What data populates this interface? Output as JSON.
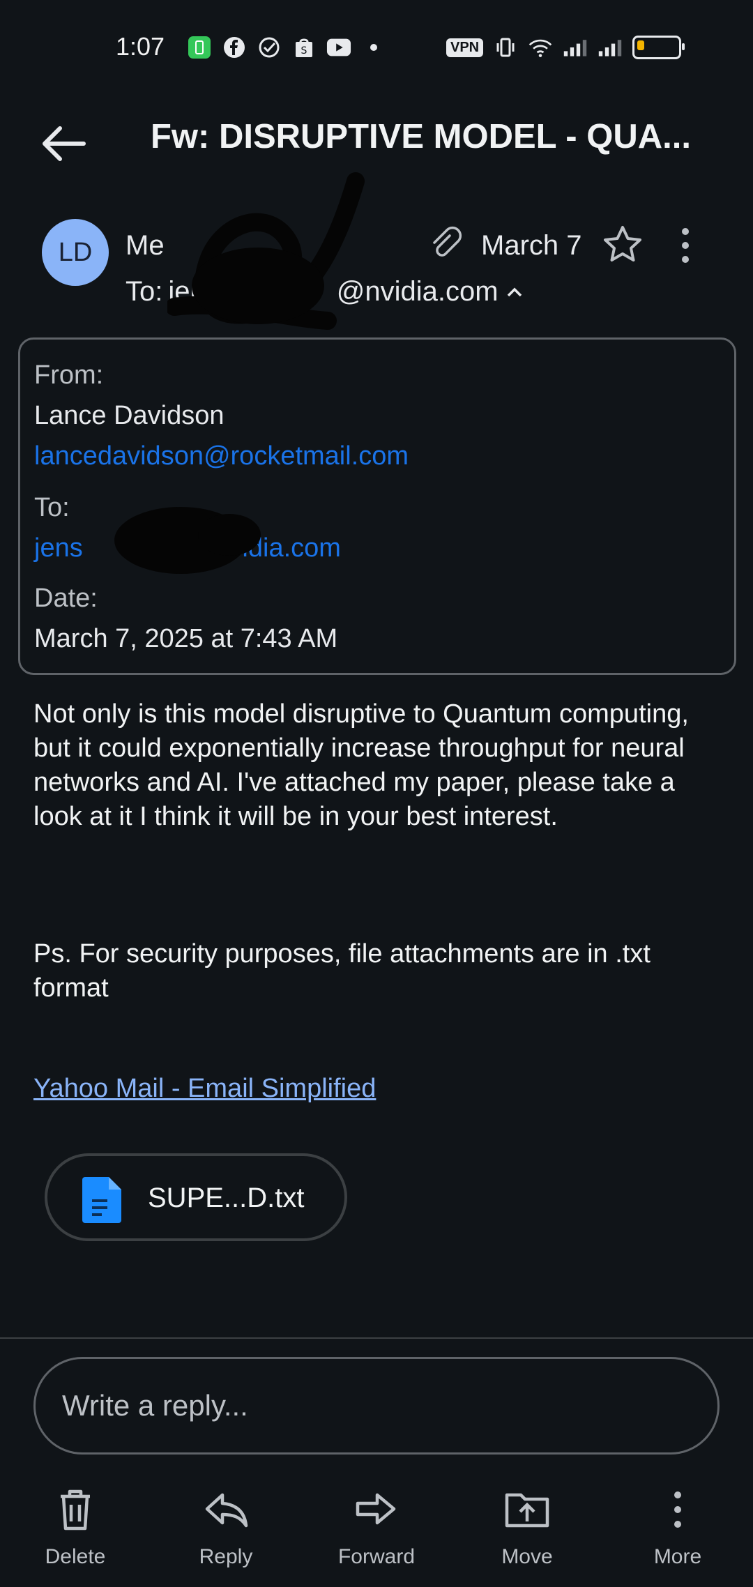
{
  "status_bar": {
    "time": "1:07",
    "vpn_label": "VPN"
  },
  "header": {
    "subject": "Fw: DISRUPTIVE MODEL - QUA..."
  },
  "message": {
    "avatar_initials": "LD",
    "sender": "Me",
    "date": "March 7",
    "to_prefix": "To:",
    "to_visible_start": "jens",
    "to_visible_end": "@nvidia.com"
  },
  "forwarded": {
    "from_label": "From:",
    "from_name": "Lance Davidson",
    "from_email": "lancedavidson@rocketmail.com",
    "to_label": "To:",
    "to_visible_start": "jens",
    "to_visible_end": "@nvidia.com",
    "date_label": "Date:",
    "date_value": "March 7, 2025 at 7:43 AM"
  },
  "body": {
    "paragraph1": "Not only is this model disruptive to Quantum computing, but it could exponentially increase throughput for neural networks and AI. I've attached my paper, please take a look at it I think it will be in your best interest.",
    "paragraph2": "Ps. For security purposes, file attachments are in .txt format",
    "footer_link": "Yahoo Mail - Email Simplified"
  },
  "attachment": {
    "file_name": "SUPE...D.txt"
  },
  "reply": {
    "placeholder": "Write a reply..."
  },
  "actions": {
    "delete": "Delete",
    "reply": "Reply",
    "forward": "Forward",
    "move": "Move",
    "more": "More"
  },
  "colors": {
    "background": "#101418",
    "link": "#1a73e8",
    "footer_link": "#8ab4f8",
    "avatar": "#8ab4f8"
  }
}
